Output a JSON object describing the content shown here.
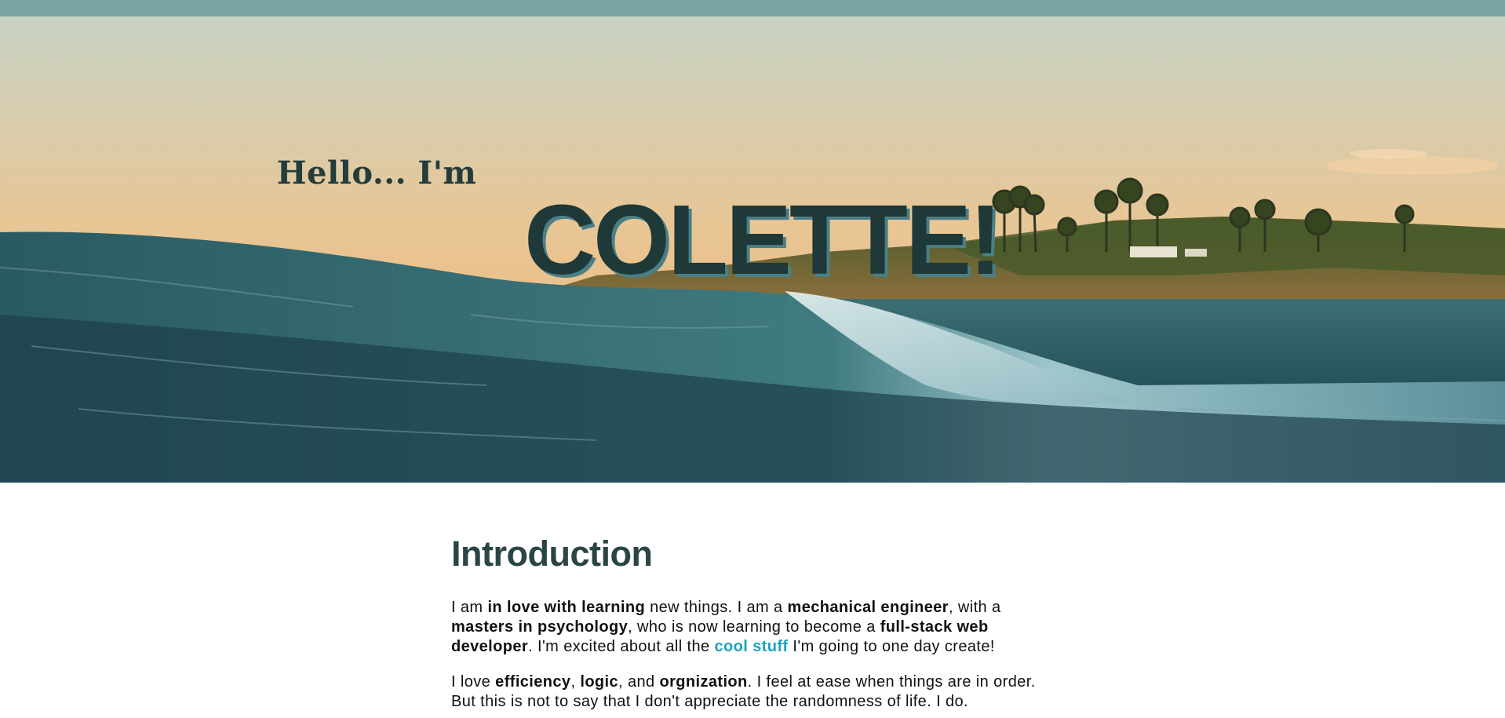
{
  "hero": {
    "greeting": "Hello... I'm",
    "name": "COLETTE!"
  },
  "intro": {
    "title": "Introduction",
    "p1": {
      "t1": "I am ",
      "b1": "in love with learning",
      "t2": " new things. I am a ",
      "b2": "mechanical engineer",
      "t3": ", with a ",
      "b3": "masters in psychology",
      "t4": ", who is now learning to become a ",
      "b4": "full-stack web developer",
      "t5": ". I'm excited about all the ",
      "link": "cool stuff",
      "t6": " I'm going to one day create!"
    },
    "p2": {
      "t1": "I love ",
      "b1": "efficiency",
      "t2": ", ",
      "b2": "logic",
      "t3": ", and ",
      "b3": "orgnization",
      "t4": ". I feel at ease when things are in order. But this is not to say that I don't appreciate the randomness of life. I do."
    }
  },
  "colors": {
    "topbar": "#7aa4a4",
    "heading": "#2b4545",
    "link": "#1ba3c0"
  }
}
